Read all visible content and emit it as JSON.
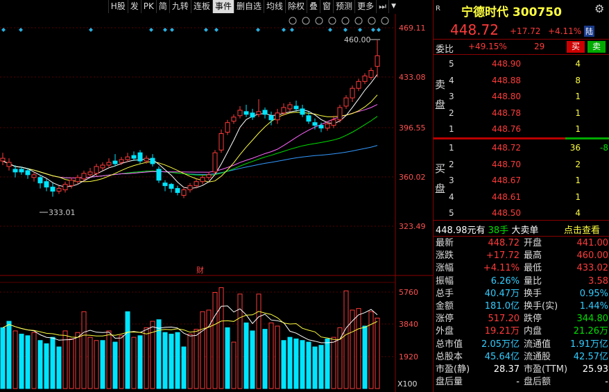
{
  "toolbar": {
    "items": [
      "H股",
      "发",
      "PK",
      "简",
      "九转",
      "连板",
      "事件",
      "删自选",
      "均线",
      "除权",
      "叠",
      "窗",
      "预测",
      "更多"
    ],
    "selected_index": 6
  },
  "price_axis": {
    "ticks": [
      "469.11",
      "433.08",
      "396.55",
      "360.02",
      "323.49"
    ]
  },
  "volume_axis": {
    "ticks": [
      "5760",
      "3840",
      "1920"
    ],
    "unit": "X100"
  },
  "chart_labels": {
    "high": "460.00",
    "low": "333.01",
    "fin_marker": "财"
  },
  "header": {
    "badge": "R",
    "name": "宁德时代",
    "code": "300750"
  },
  "quote": {
    "price": "448.72",
    "change": "+17.72",
    "change_pct": "+4.11%",
    "tag": "陆"
  },
  "weibi": {
    "label": "委比",
    "pct": "+49.15%",
    "diff": "29",
    "sell_btn": "买",
    "buy_btn": "卖"
  },
  "sell_book": {
    "side_label": "卖盘",
    "rows": [
      {
        "level": "5",
        "price": "448.90",
        "vol": "4"
      },
      {
        "level": "4",
        "price": "448.88",
        "vol": "8"
      },
      {
        "level": "3",
        "price": "448.80",
        "vol": "1"
      },
      {
        "level": "2",
        "price": "448.78",
        "vol": "1"
      },
      {
        "level": "1",
        "price": "448.76",
        "vol": "1"
      }
    ]
  },
  "buy_book": {
    "side_label": "买盘",
    "rows": [
      {
        "level": "1",
        "price": "448.72",
        "vol": "36",
        "extra": "-8"
      },
      {
        "level": "2",
        "price": "448.70",
        "vol": "2",
        "extra": ""
      },
      {
        "level": "3",
        "price": "448.67",
        "vol": "1",
        "extra": ""
      },
      {
        "level": "4",
        "price": "448.61",
        "vol": "1",
        "extra": ""
      },
      {
        "level": "5",
        "price": "448.50",
        "vol": "4",
        "extra": ""
      }
    ]
  },
  "big_order": {
    "price": "448.98",
    "unit": "元有",
    "qty": "38手",
    "type": "大卖单",
    "link": "点击查看"
  },
  "stats": [
    {
      "l1": "最新",
      "v1": "448.72",
      "c1": "red",
      "l2": "开盘",
      "v2": "441.00",
      "c2": "red"
    },
    {
      "l1": "涨跌",
      "v1": "+17.72",
      "c1": "red",
      "l2": "最高",
      "v2": "460.00",
      "c2": "red"
    },
    {
      "l1": "涨幅",
      "v1": "+4.11%",
      "c1": "red",
      "l2": "最低",
      "v2": "433.02",
      "c2": "red"
    },
    {
      "l1": "振幅",
      "v1": "6.26%",
      "c1": "cyan",
      "l2": "量比",
      "v2": "3.58",
      "c2": "red"
    },
    {
      "l1": "总手",
      "v1": "40.47万",
      "c1": "cyan",
      "l2": "换手",
      "v2": "0.95%",
      "c2": "cyan"
    },
    {
      "l1": "金额",
      "v1": "181.0亿",
      "c1": "cyan",
      "l2": "换手(实)",
      "v2": "1.44%",
      "c2": "cyan"
    },
    {
      "l1": "涨停",
      "v1": "517.20",
      "c1": "red",
      "l2": "跌停",
      "v2": "344.80",
      "c2": "green"
    },
    {
      "l1": "外盘",
      "v1": "19.21万",
      "c1": "red",
      "l2": "内盘",
      "v2": "21.26万",
      "c2": "green"
    },
    {
      "l1": "总市值",
      "v1": "2.05万亿",
      "c1": "cyan",
      "l2": "流通值",
      "v2": "1.91万亿",
      "c2": "cyan"
    },
    {
      "l1": "总股本",
      "v1": "45.64亿",
      "c1": "cyan",
      "l2": "流通股",
      "v2": "42.57亿",
      "c2": "cyan"
    },
    {
      "l1": "市盈(静)",
      "v1": "28.37",
      "c1": "white",
      "l2": "市盈(TTM)",
      "v2": "25.93",
      "c2": "white"
    },
    {
      "l1": "盘后量",
      "v1": "-",
      "c1": "white",
      "l2": "盘后额",
      "v2": "-",
      "c2": "white"
    }
  ],
  "colors": {
    "up": "#ff3b3b",
    "down": "#00e5ff",
    "ma5": "#ffffff",
    "ma10": "#ffff40",
    "ma20": "#ff66ff",
    "ma30": "#00dd00",
    "ma60": "#3399ff"
  },
  "chart_data": {
    "type": "candlestick",
    "y_range": [
      323.49,
      469.11
    ],
    "volume_range": [
      0,
      6500
    ],
    "candles": [
      [
        374,
        372,
        378,
        369,
        1
      ],
      [
        371,
        368,
        374,
        365,
        1
      ],
      [
        366,
        364,
        369,
        360,
        0
      ],
      [
        364,
        366,
        368,
        362,
        0
      ],
      [
        365,
        362,
        367,
        359,
        0
      ],
      [
        362,
        360,
        364,
        357,
        1
      ],
      [
        360,
        356,
        362,
        352,
        0
      ],
      [
        357,
        353,
        359,
        350,
        0
      ],
      [
        353,
        350,
        356,
        346,
        0
      ],
      [
        350,
        352,
        354,
        348,
        1
      ],
      [
        351,
        355,
        357,
        349,
        1
      ],
      [
        354,
        358,
        360,
        352,
        1
      ],
      [
        357,
        360,
        362,
        355,
        1
      ],
      [
        359,
        363,
        365,
        357,
        1
      ],
      [
        362,
        364,
        367,
        360,
        1
      ],
      [
        363,
        368,
        370,
        361,
        1
      ],
      [
        367,
        369,
        371,
        365,
        1
      ],
      [
        369,
        371,
        374,
        367,
        1
      ],
      [
        372,
        370,
        377,
        368,
        0
      ],
      [
        371,
        373,
        375,
        369,
        1
      ],
      [
        373,
        375,
        378,
        371,
        1
      ],
      [
        376,
        374,
        379,
        372,
        0
      ],
      [
        378,
        372,
        380,
        370,
        0
      ],
      [
        372,
        374,
        376,
        370,
        1
      ],
      [
        374,
        370,
        377,
        368,
        0
      ],
      [
        366,
        358,
        368,
        356,
        0
      ],
      [
        356,
        354,
        358,
        350,
        0
      ],
      [
        355,
        352,
        356,
        349,
        0
      ],
      [
        352,
        349,
        354,
        347,
        0
      ],
      [
        347,
        351,
        353,
        345,
        1
      ],
      [
        351,
        354,
        356,
        349,
        1
      ],
      [
        354,
        357,
        359,
        352,
        1
      ],
      [
        357,
        360,
        362,
        355,
        1
      ],
      [
        360,
        362,
        364,
        358,
        1
      ],
      [
        364,
        378,
        380,
        362,
        1
      ],
      [
        380,
        392,
        395,
        378,
        1
      ],
      [
        393,
        400,
        402,
        391,
        1
      ],
      [
        401,
        404,
        406,
        399,
        1
      ],
      [
        405,
        409,
        412,
        403,
        1
      ],
      [
        408,
        406,
        413,
        404,
        0
      ],
      [
        407,
        404,
        410,
        402,
        0
      ],
      [
        406,
        408,
        417,
        404,
        1
      ],
      [
        409,
        406,
        411,
        403,
        0
      ],
      [
        405,
        402,
        408,
        398,
        0
      ],
      [
        402,
        407,
        410,
        399,
        1
      ],
      [
        407,
        411,
        414,
        405,
        1
      ],
      [
        410,
        413,
        415,
        408,
        1
      ],
      [
        412,
        410,
        416,
        408,
        0
      ],
      [
        410,
        406,
        413,
        404,
        0
      ],
      [
        405,
        401,
        408,
        399,
        0
      ],
      [
        400,
        398,
        403,
        395,
        0
      ],
      [
        398,
        396,
        400,
        393,
        0
      ],
      [
        396,
        399,
        401,
        394,
        1
      ],
      [
        398,
        402,
        405,
        396,
        1
      ],
      [
        402,
        411,
        413,
        400,
        1
      ],
      [
        412,
        418,
        420,
        410,
        1
      ],
      [
        418,
        425,
        427,
        415,
        1
      ],
      [
        425,
        430,
        432,
        423,
        1
      ],
      [
        430,
        434,
        436,
        428,
        1
      ],
      [
        433,
        438,
        440,
        431,
        1
      ],
      [
        441,
        448.72,
        460,
        433.02,
        1
      ]
    ],
    "volumes": [
      [
        3800,
        0
      ],
      [
        4200,
        0
      ],
      [
        3600,
        1
      ],
      [
        3400,
        0
      ],
      [
        3300,
        0
      ],
      [
        3500,
        1
      ],
      [
        3000,
        0
      ],
      [
        2800,
        0
      ],
      [
        3200,
        0
      ],
      [
        2600,
        0
      ],
      [
        3600,
        1
      ],
      [
        3100,
        1
      ],
      [
        3500,
        1
      ],
      [
        4800,
        1
      ],
      [
        3200,
        1
      ],
      [
        3000,
        1
      ],
      [
        3000,
        0
      ],
      [
        3600,
        1
      ],
      [
        2900,
        0
      ],
      [
        3300,
        1
      ],
      [
        4800,
        0
      ],
      [
        3200,
        1
      ],
      [
        3300,
        0
      ],
      [
        3800,
        1
      ],
      [
        4200,
        1
      ],
      [
        4300,
        0
      ],
      [
        3500,
        0
      ],
      [
        3400,
        0
      ],
      [
        3500,
        0
      ],
      [
        2600,
        0
      ],
      [
        3400,
        1
      ],
      [
        3700,
        1
      ],
      [
        4800,
        1
      ],
      [
        4900,
        1
      ],
      [
        6000,
        1
      ],
      [
        6300,
        1
      ],
      [
        3800,
        0
      ],
      [
        2900,
        1
      ],
      [
        5900,
        1
      ],
      [
        4100,
        0
      ],
      [
        3600,
        0
      ],
      [
        5900,
        1
      ],
      [
        3700,
        0
      ],
      [
        4100,
        1
      ],
      [
        3900,
        1
      ],
      [
        3000,
        0
      ],
      [
        3200,
        0
      ],
      [
        3100,
        0
      ],
      [
        3000,
        0
      ],
      [
        2900,
        0
      ],
      [
        2600,
        0
      ],
      [
        2700,
        0
      ],
      [
        3100,
        0
      ],
      [
        3200,
        1
      ],
      [
        3800,
        1
      ],
      [
        6100,
        1
      ],
      [
        4900,
        1
      ],
      [
        5000,
        1
      ],
      [
        3900,
        0
      ],
      [
        4800,
        1
      ],
      [
        4400,
        1
      ]
    ]
  }
}
